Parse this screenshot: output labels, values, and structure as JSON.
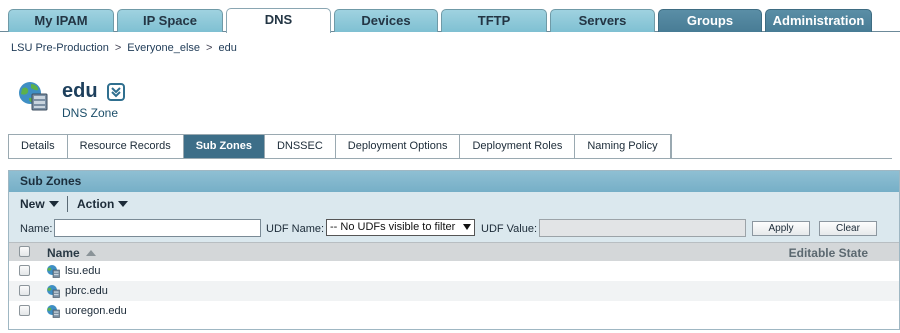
{
  "top_tabs": [
    {
      "label": "My IPAM",
      "state": "normal"
    },
    {
      "label": "IP Space",
      "state": "normal"
    },
    {
      "label": "DNS",
      "state": "active"
    },
    {
      "label": "Devices",
      "state": "normal"
    },
    {
      "label": "TFTP",
      "state": "normal"
    },
    {
      "label": "Servers",
      "state": "normal"
    },
    {
      "label": "Groups",
      "state": "dark"
    },
    {
      "label": "Administration",
      "state": "dark"
    }
  ],
  "breadcrumb": [
    "LSU Pre-Production",
    "Everyone_else",
    "edu"
  ],
  "breadcrumb_separator": ">",
  "page": {
    "title": "edu",
    "subtitle": "DNS Zone",
    "icon": "dns-zone-icon"
  },
  "sub_tabs": [
    {
      "label": "Details",
      "active": false
    },
    {
      "label": "Resource Records",
      "active": false
    },
    {
      "label": "Sub Zones",
      "active": true
    },
    {
      "label": "DNSSEC",
      "active": false
    },
    {
      "label": "Deployment Options",
      "active": false
    },
    {
      "label": "Deployment Roles",
      "active": false
    },
    {
      "label": "Naming Policy",
      "active": false
    }
  ],
  "panel": {
    "title": "Sub Zones",
    "toolbar": {
      "new_label": "New",
      "action_label": "Action"
    },
    "filter": {
      "name_label": "Name:",
      "name_value": "",
      "udf_name_label": "UDF Name:",
      "udf_select_value": "-- No UDFs visible to filter",
      "udf_value_label": "UDF Value:",
      "udf_value": "",
      "apply_label": "Apply",
      "clear_label": "Clear"
    },
    "columns": {
      "name": "Name",
      "state": "Editable State"
    },
    "rows": [
      {
        "name": "lsu.edu"
      },
      {
        "name": "pbrc.edu"
      },
      {
        "name": "uoregon.edu"
      }
    ]
  },
  "colors": {
    "tab_light": "#8fc9da",
    "tab_dark": "#4f859d",
    "active_subtab": "#3d6e88",
    "panel_header": "#82b7cc",
    "toolbar_bg": "#dbe8ee"
  }
}
